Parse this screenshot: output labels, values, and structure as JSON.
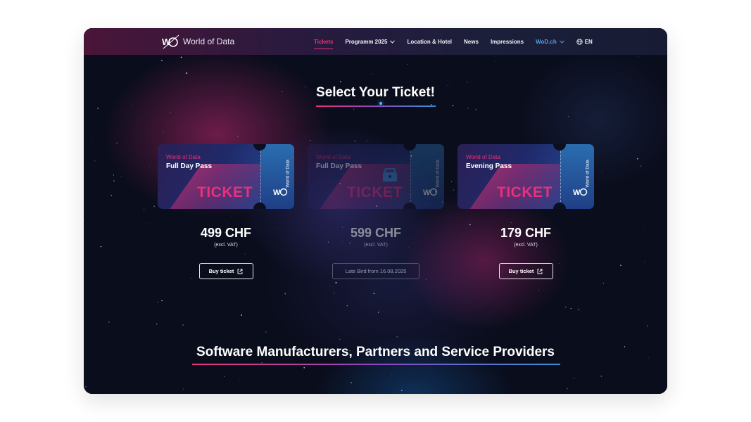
{
  "header": {
    "brand": "World of Data",
    "nav": [
      {
        "label": "Tickets",
        "active": true
      },
      {
        "label": "Programm 2025",
        "dropdown": true
      },
      {
        "label": "Location & Hotel"
      },
      {
        "label": "News"
      },
      {
        "label": "Impressions"
      },
      {
        "label": "WoD.ch",
        "dropdown": true,
        "accent": "#4aa3ec"
      }
    ],
    "language": "EN"
  },
  "section_title": "Select Your Ticket!",
  "tickets": [
    {
      "brand": "World of Data",
      "name": "Full Day Pass",
      "word": "TICKET",
      "stub_text": "World of Data",
      "price": "499 CHF",
      "vat": "(excl. VAT)",
      "button": "Buy ticket",
      "available": true
    },
    {
      "brand": "World of Data",
      "name": "Full Day Pass",
      "word": "TICKET",
      "stub_text": "World of Data",
      "price": "599 CHF",
      "vat": "(excl. VAT)",
      "button": "Late Bird from 16.08.2025",
      "available": false
    },
    {
      "brand": "World of Data",
      "name": "Evening Pass",
      "word": "TICKET",
      "stub_text": "World of Data",
      "price": "179 CHF",
      "vat": "(excl. VAT)",
      "button": "Buy ticket",
      "available": true
    }
  ],
  "partners_title": "Software Manufacturers, Partners and Service Providers",
  "colors": {
    "accent": "#e8317a",
    "link_blue": "#4aa3ec",
    "background": "#0a0d1c"
  },
  "icons": [
    "wod-logo-icon",
    "chevron-down-icon",
    "globe-icon",
    "external-link-icon",
    "ticket-cart-icon"
  ]
}
